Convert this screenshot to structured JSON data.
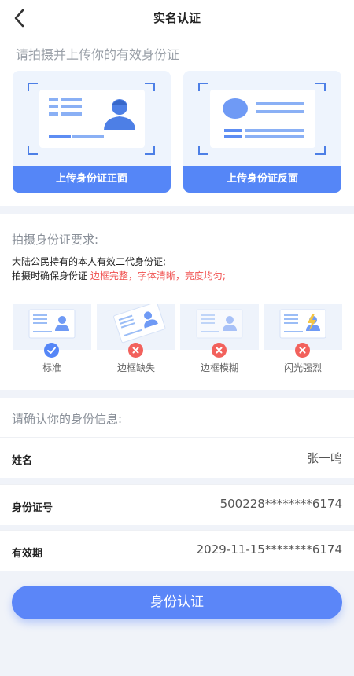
{
  "header": {
    "title": "实名认证"
  },
  "upload": {
    "prompt": "请拍摄并上传你的有效身份证",
    "front_label": "上传身份证正面",
    "back_label": "上传身份证反面"
  },
  "requirements": {
    "title": "拍摄身份证要求:",
    "line1": "大陆公民持有的本人有效二代身份证;",
    "line2_prefix": "拍摄时确保身份证 ",
    "line2_highlight": "边框完整，字体清晰，亮度均匀;",
    "examples": [
      {
        "label": "标准",
        "status": "ok"
      },
      {
        "label": "边框缺失",
        "status": "error"
      },
      {
        "label": "边框模糊",
        "status": "error"
      },
      {
        "label": "闪光强烈",
        "status": "error"
      }
    ]
  },
  "info": {
    "title": "请确认你的身份信息:",
    "fields": [
      {
        "label": "姓名",
        "value": "张一鸣"
      },
      {
        "label": "身份证号",
        "value": "500228********6174"
      },
      {
        "label": "有效期",
        "value": "2029-11-15********6174"
      }
    ]
  },
  "submit_label": "身份认证",
  "colors": {
    "accent": "#5586f7",
    "error": "#f2615c",
    "card_bg": "#eef4fd"
  }
}
